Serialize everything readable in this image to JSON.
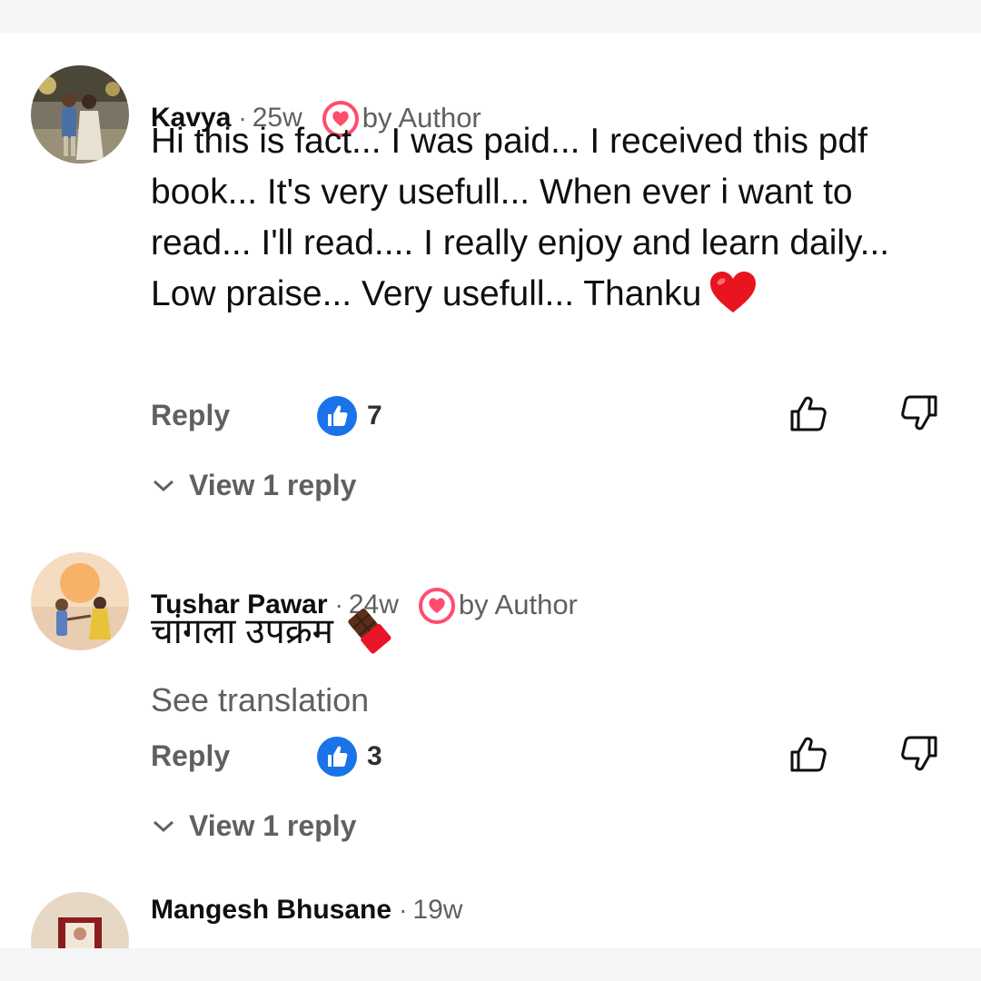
{
  "colors": {
    "accent_blue": "#1a73e8",
    "author_heart": "#ff4d6d",
    "secondary_text": "#606060"
  },
  "comments": [
    {
      "author": "Kavya",
      "time": "25w",
      "badge": "by Author",
      "text": "Hi this is fact... I was paid... I received this pdf book... It's very usefull... When ever i want to read... I'll read.... I really enjoy and learn daily... Low praise... Very usefull... Thanku",
      "emoji": "red-heart",
      "reply_label": "Reply",
      "likes": "7",
      "view_replies": "View 1 reply"
    },
    {
      "author": "Tushar Pawar",
      "time": "24w",
      "badge": "by Author",
      "text": "चांगला उपक्रम",
      "emoji": "chocolate-bar",
      "see_translation": "See translation",
      "reply_label": "Reply",
      "likes": "3",
      "view_replies": "View 1 reply"
    },
    {
      "author": "Mangesh Bhusane",
      "time": "19w"
    }
  ]
}
